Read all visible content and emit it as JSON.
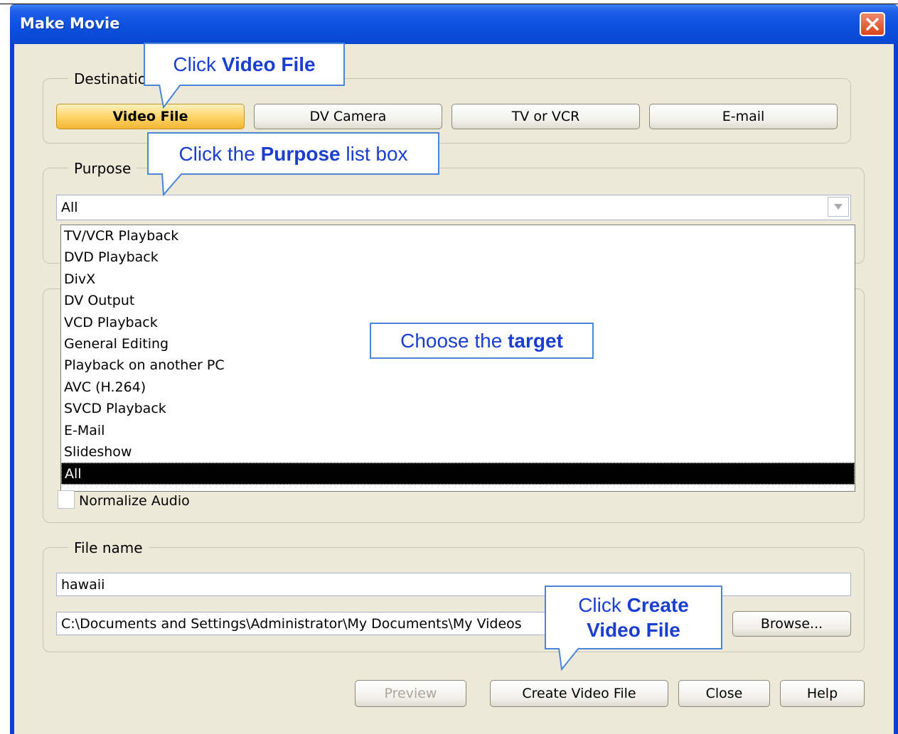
{
  "window": {
    "title": "Make Movie"
  },
  "destination": {
    "label": "Destination",
    "buttons": [
      "Video File",
      "DV Camera",
      "TV or VCR",
      "E-mail"
    ]
  },
  "purpose": {
    "label": "Purpose",
    "selected": "All",
    "options": [
      "TV/VCR Playback",
      "DVD Playback",
      "DivX",
      "DV Output",
      "VCD Playback",
      "General Editing",
      "Playback on another PC",
      "AVC (H.264)",
      "SVCD Playback",
      "E-Mail",
      "Slideshow",
      "All"
    ]
  },
  "normalize_audio": {
    "label": "Normalize Audio",
    "checked": false
  },
  "file": {
    "label": "File name",
    "name_value": "hawaii",
    "path_value": "C:\\Documents and Settings\\Administrator\\My Documents\\My Videos",
    "browse_label": "Browse..."
  },
  "footer": {
    "preview_label": "Preview",
    "create_label": "Create Video File",
    "close_label": "Close",
    "help_label": "Help"
  },
  "callouts": {
    "video_file": {
      "pre": "Click ",
      "bold": "Video File",
      "post": ""
    },
    "purpose": {
      "pre": "Click the ",
      "bold": "Purpose",
      "post": " list box"
    },
    "target": {
      "pre": "Choose the ",
      "bold": "target",
      "post": ""
    },
    "create": {
      "line1_pre": "Click ",
      "line1_bold": "Create",
      "line2_bold": "Video File"
    }
  }
}
